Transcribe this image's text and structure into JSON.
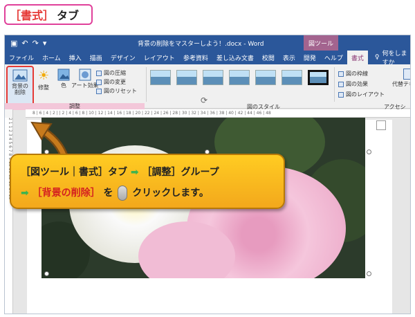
{
  "heading": {
    "bracket": "［書式］",
    "suffix": "タブ"
  },
  "qat": {
    "save_icon": "save-icon",
    "undo": "↶",
    "redo": "↷",
    "more": "▾"
  },
  "title": "背景の削除をマスターしよう！.docx - Word",
  "context_tab": "図ツール",
  "menu": [
    "ファイル",
    "ホーム",
    "挿入",
    "描画",
    "デザイン",
    "レイアウト",
    "参考資料",
    "差し込み文書",
    "校閲",
    "表示",
    "開発",
    "ヘルプ",
    "書式"
  ],
  "tellme": "何をしますか",
  "ribbon": {
    "bg_remove": "背景の\n削除",
    "correct": "修整",
    "color": "色",
    "art": "アート効果",
    "compress": "図の圧縮",
    "change": "図の変更",
    "reset": "図のリセット",
    "adjust_group": "調整",
    "styles_group": "図のスタイル",
    "border": "図の枠線",
    "effect": "図の効果",
    "layout": "図のレイアウト",
    "alt_text": "代替テキスト",
    "alt_group": "アクセシ"
  },
  "ruler_text": "8 | 6 | 4 | 2 | | 2 | 4 | 6 | 8 | 10 | 12 | 14 | 16 | 18 | 20 | 22 | 24 | 26 | 28 | 30 | 32 | 34 | 36 | 38 | 40 | 42 | 44 | 46 | 48",
  "vruler_text": "2 1 1 2 3 4 5 6 7 8 9 10 11 12 13 14 15",
  "callout": {
    "line1_a": "［図ツール｜書式］タブ",
    "arrow": "➡",
    "line1_b": "［調整］グループ",
    "line2_a": "［背景の削除］",
    "line2_b": "を",
    "line2_c": "クリックします。"
  },
  "colors": {
    "word_blue": "#2b579a",
    "context_purple": "#a3648f",
    "highlight_red": "#e53935",
    "callout_yellow": "#ffcc22"
  }
}
